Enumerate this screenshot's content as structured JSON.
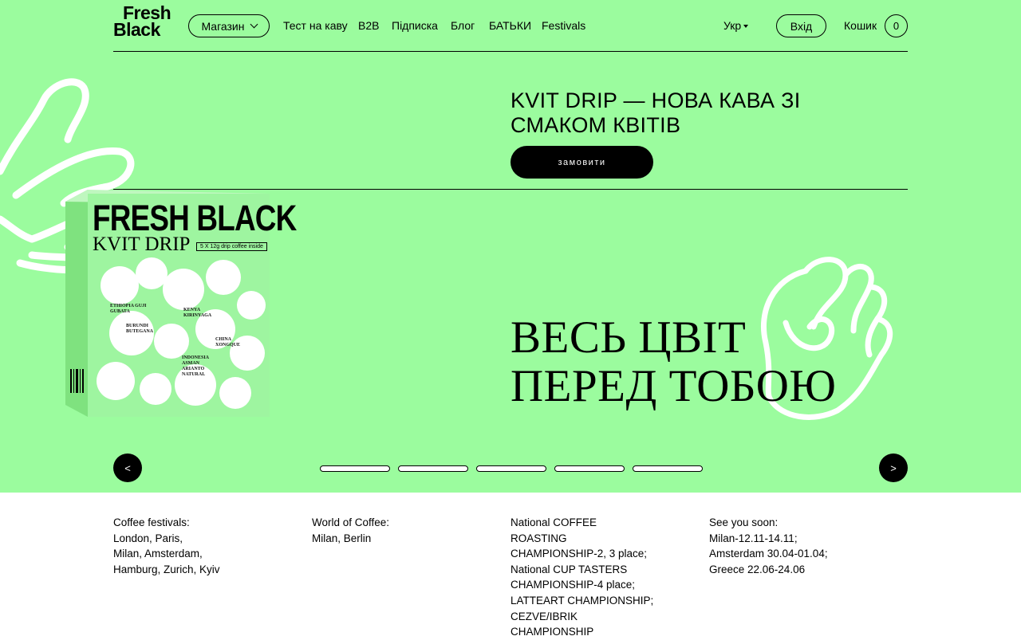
{
  "header": {
    "logo": {
      "line1": "Fresh",
      "line2": "Black"
    },
    "shop_label": "Магазин",
    "nav_items": [
      "Тест на каву",
      "B2B",
      "Підписка",
      "Блог",
      "БАТЬКИ",
      "Festivals"
    ],
    "language": "Укр",
    "login_label": "Вхід",
    "cart_label": "Кошик",
    "cart_count": "0"
  },
  "hero": {
    "heading": "KVIT DRIP — НОВА КАВА ЗІ СМАКОМ КВІТІВ",
    "order_label": "замовити",
    "tagline": "ВЕСЬ ЦВІТ ПЕРЕД ТОБОЮ",
    "product": {
      "brand": "FRESH BLACK",
      "name": "KVIT DRIP",
      "note": "5 X 12g drip coffee inside",
      "origins": [
        "ETHIOPIA GUJI GUBATA",
        "BURUNDI BUTEGANA",
        "KENYA KIRINYAGA",
        "CHINA XONGQUE",
        "INDONESIA ASMAN ARIANTO NATURAL"
      ]
    },
    "slider": {
      "prev_label": "<",
      "next_label": ">",
      "slide_count": 5
    }
  },
  "info": {
    "columns": [
      "Coffee festivals:\nLondon, Paris,\nMilan, Amsterdam,\nHamburg, Zurich, Kyiv",
      "World of Coffee:\nMilan, Berlin",
      "National COFFEE\nROASTING\nCHAMPIONSHIP-2, 3 place;\nNational CUP TASTERS\nCHAMPIONSHIP-4 place;\nLATTEART CHAMPIONSHIP;\nCEZVE/IBRIK\nCHAMPIONSHIP",
      "See you soon:\nMilan-12.11-14.11;\nAmsterdam 30.04-01.04;\nGreece 22.06-24.06"
    ]
  },
  "colors": {
    "hero_bg": "#9bfc9e",
    "accent": "#000000",
    "text": "#000000"
  }
}
